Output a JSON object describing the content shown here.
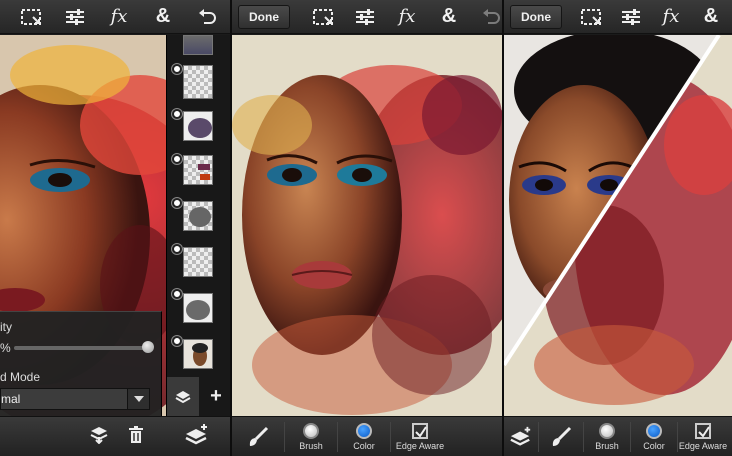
{
  "panel1": {
    "layer_panel": {
      "opacity_label": "ity",
      "opacity_value": "%",
      "opacity_fraction": 0.93,
      "blend_label": "d Mode",
      "blend_value": "mal"
    },
    "layer_thumbs": [
      "layer-1",
      "layer-2",
      "layer-3",
      "layer-4",
      "layer-5",
      "layer-6",
      "layer-7",
      "layer-8"
    ]
  },
  "panel2": {
    "done_label": "Done",
    "tools": {
      "brush": "Brush",
      "color": "Color",
      "edge": "Edge Aware"
    }
  },
  "panel3": {
    "done_label": "Done",
    "tools": {
      "brush": "Brush",
      "color": "Color",
      "edge": "Edge Aware"
    }
  },
  "icons": {
    "select": "select-icon",
    "adjust": "adjust-icon",
    "fx": "fx",
    "blend": "&",
    "undo": "undo-icon"
  },
  "colors": {
    "toolbar": "#2c2c2c",
    "accent_blue": "#1e7ae6"
  }
}
